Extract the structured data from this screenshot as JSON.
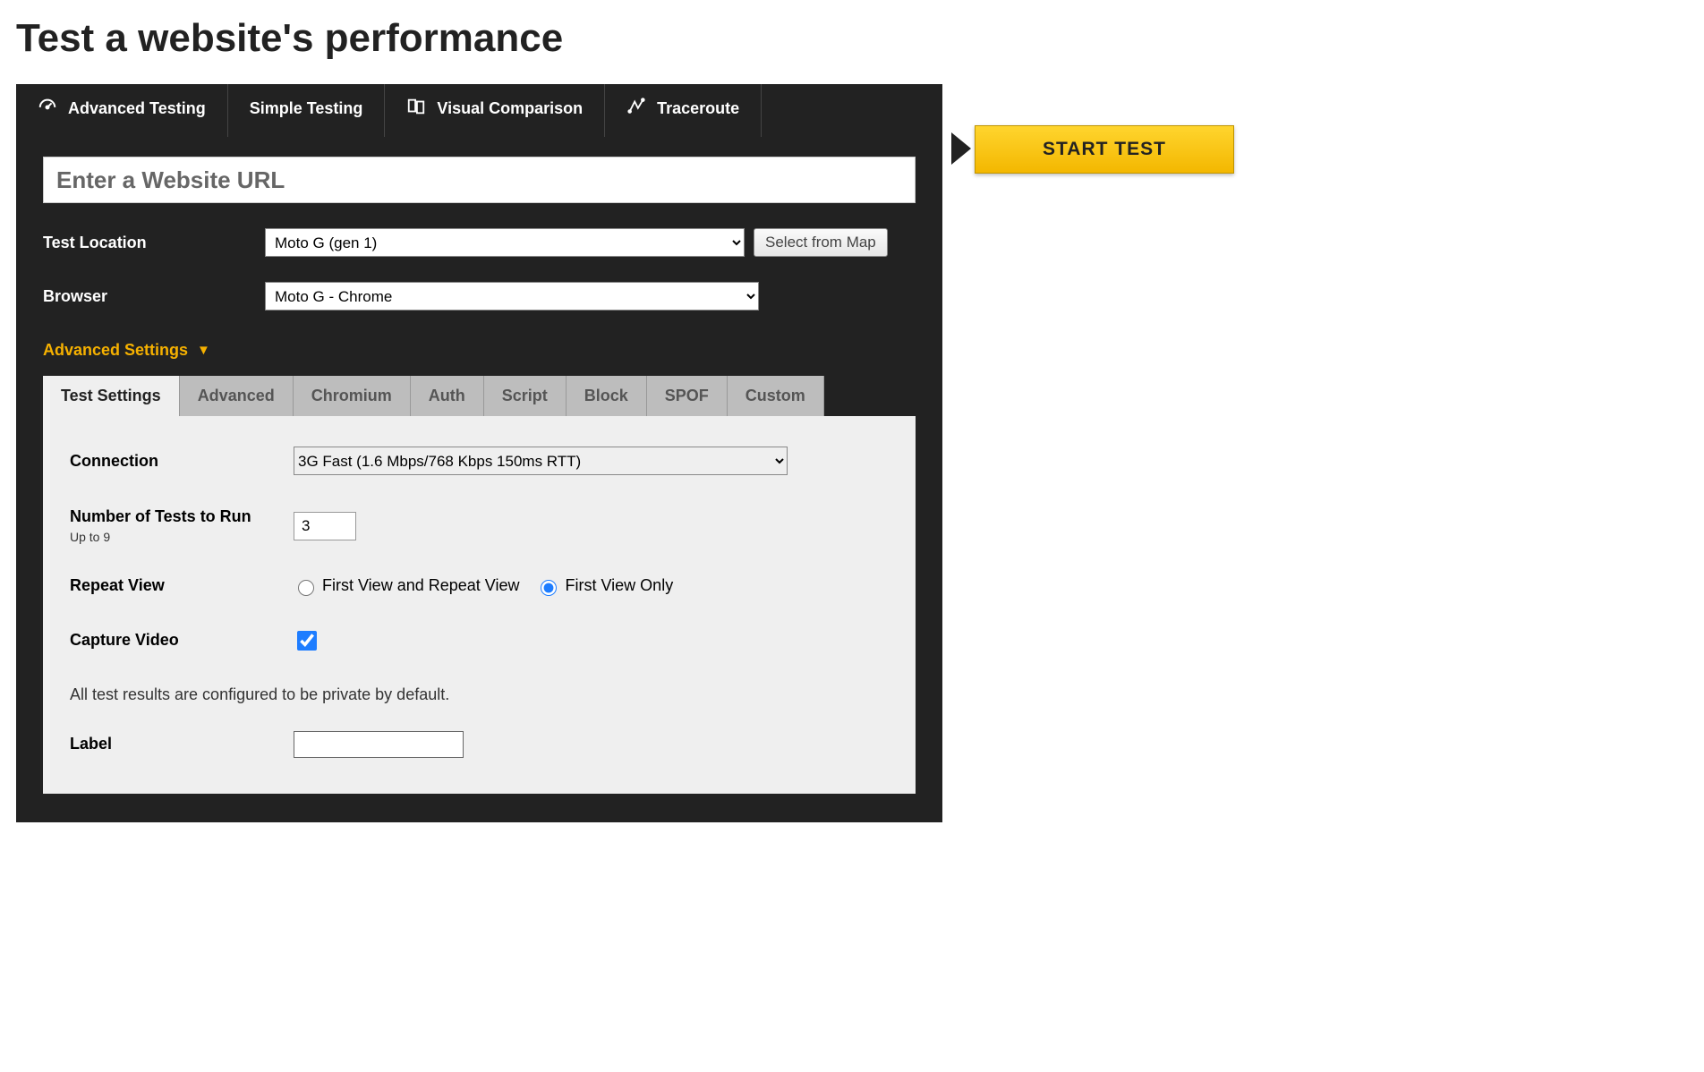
{
  "page_title": "Test a website's performance",
  "tabs": {
    "advanced": "Advanced Testing",
    "simple": "Simple Testing",
    "visual": "Visual Comparison",
    "traceroute": "Traceroute"
  },
  "url_placeholder": "Enter a Website URL",
  "location": {
    "label": "Test Location",
    "selected": "Moto G (gen 1)",
    "map_button": "Select from Map"
  },
  "browser": {
    "label": "Browser",
    "selected": "Moto G - Chrome"
  },
  "advanced_toggle": "Advanced Settings",
  "settings_tabs": [
    "Test Settings",
    "Advanced",
    "Chromium",
    "Auth",
    "Script",
    "Block",
    "SPOF",
    "Custom"
  ],
  "settings": {
    "connection_label": "Connection",
    "connection_selected": "3G Fast (1.6 Mbps/768 Kbps 150ms RTT)",
    "tests_label": "Number of Tests to Run",
    "tests_sub": "Up to 9",
    "tests_value": "3",
    "repeat_label": "Repeat View",
    "repeat_opt1": "First View and Repeat View",
    "repeat_opt2": "First View Only",
    "video_label": "Capture Video",
    "private_note": "All test results are configured to be private by default.",
    "label_label": "Label",
    "label_value": ""
  },
  "start_button": "START TEST"
}
